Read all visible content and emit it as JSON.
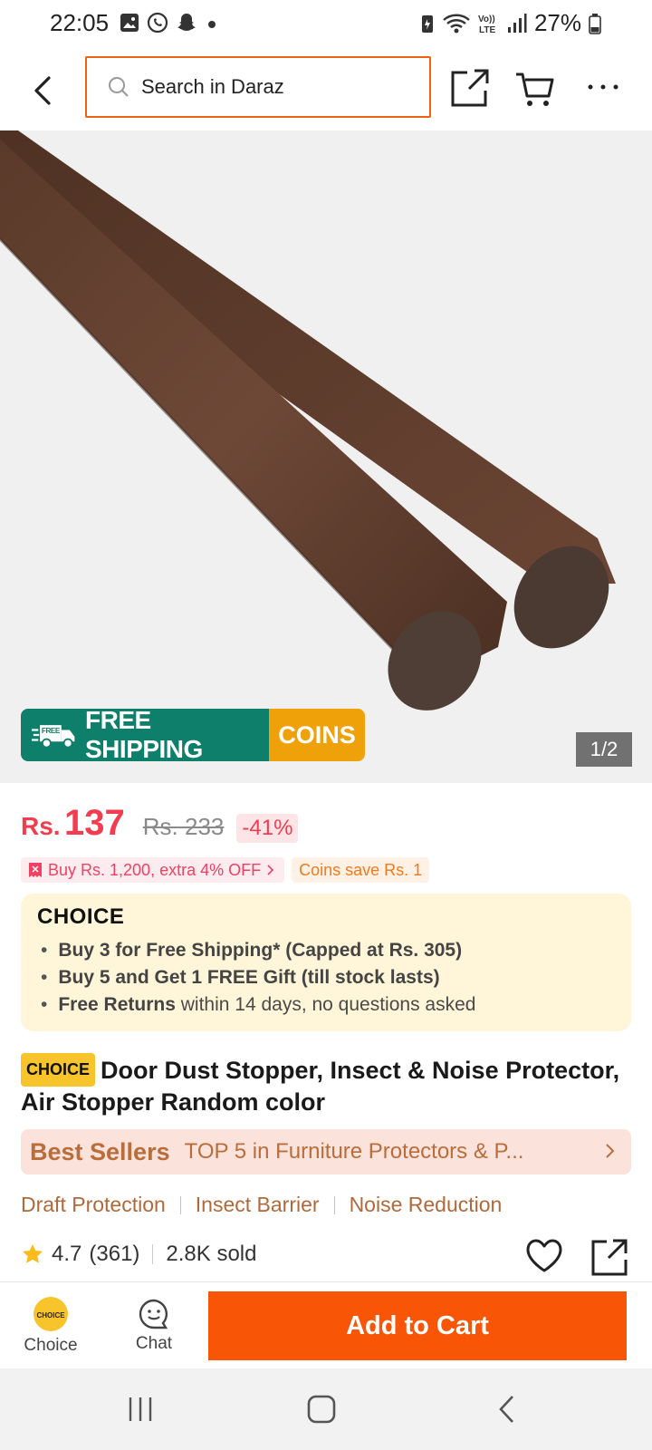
{
  "status_bar": {
    "time": "22:05",
    "battery": "27%",
    "left_icons": [
      "gallery-icon",
      "whatsapp-icon",
      "snapchat-icon",
      "dot-icon"
    ],
    "right_icons": [
      "battery-saver-icon",
      "wifi-icon",
      "volte-icon",
      "signal-icon",
      "battery-icon"
    ]
  },
  "header": {
    "search_placeholder": "Search in Daraz"
  },
  "gallery": {
    "promo_free_shipping": "FREE SHIPPING",
    "promo_free_badge": "FREE",
    "promo_coins": "COINS",
    "counter": "1/2"
  },
  "price": {
    "currency": "Rs.",
    "current": "137",
    "original": "Rs. 233",
    "discount": "-41%"
  },
  "tags": {
    "bundle": "Buy Rs. 1,200, extra 4% OFF",
    "coins": "Coins save Rs. 1"
  },
  "choice": {
    "logo": "CHOICE",
    "items": [
      {
        "bold": "Buy 3 for  Free Shipping* (Capped at Rs. 305)",
        "rest": ""
      },
      {
        "bold": "Buy 5 and Get 1 FREE Gift (till stock lasts)",
        "rest": ""
      },
      {
        "bold": "Free Returns",
        "rest": " within 14 days, no questions asked"
      }
    ]
  },
  "product": {
    "badge": "CHOICE",
    "title": "Door Dust Stopper, Insect & Noise Protector, Air Stopper Random color"
  },
  "best_sellers": {
    "label": "Best Sellers",
    "text": "TOP 5 in Furniture Protectors & P..."
  },
  "features": [
    "Draft Protection",
    "Insect Barrier",
    "Noise Reduction"
  ],
  "rating": {
    "score": "4.7",
    "count": "(361)",
    "sold": "2.8K sold"
  },
  "actions": {
    "choice_label": "Choice",
    "choice_icon_text": "CHOICE",
    "chat_label": "Chat",
    "add_to_cart": "Add to Cart"
  },
  "colors": {
    "brand_orange": "#f85606",
    "price_red": "#f23d4f",
    "free_shipping_green": "#0e7f6b",
    "coins_yellow": "#efa10a"
  }
}
